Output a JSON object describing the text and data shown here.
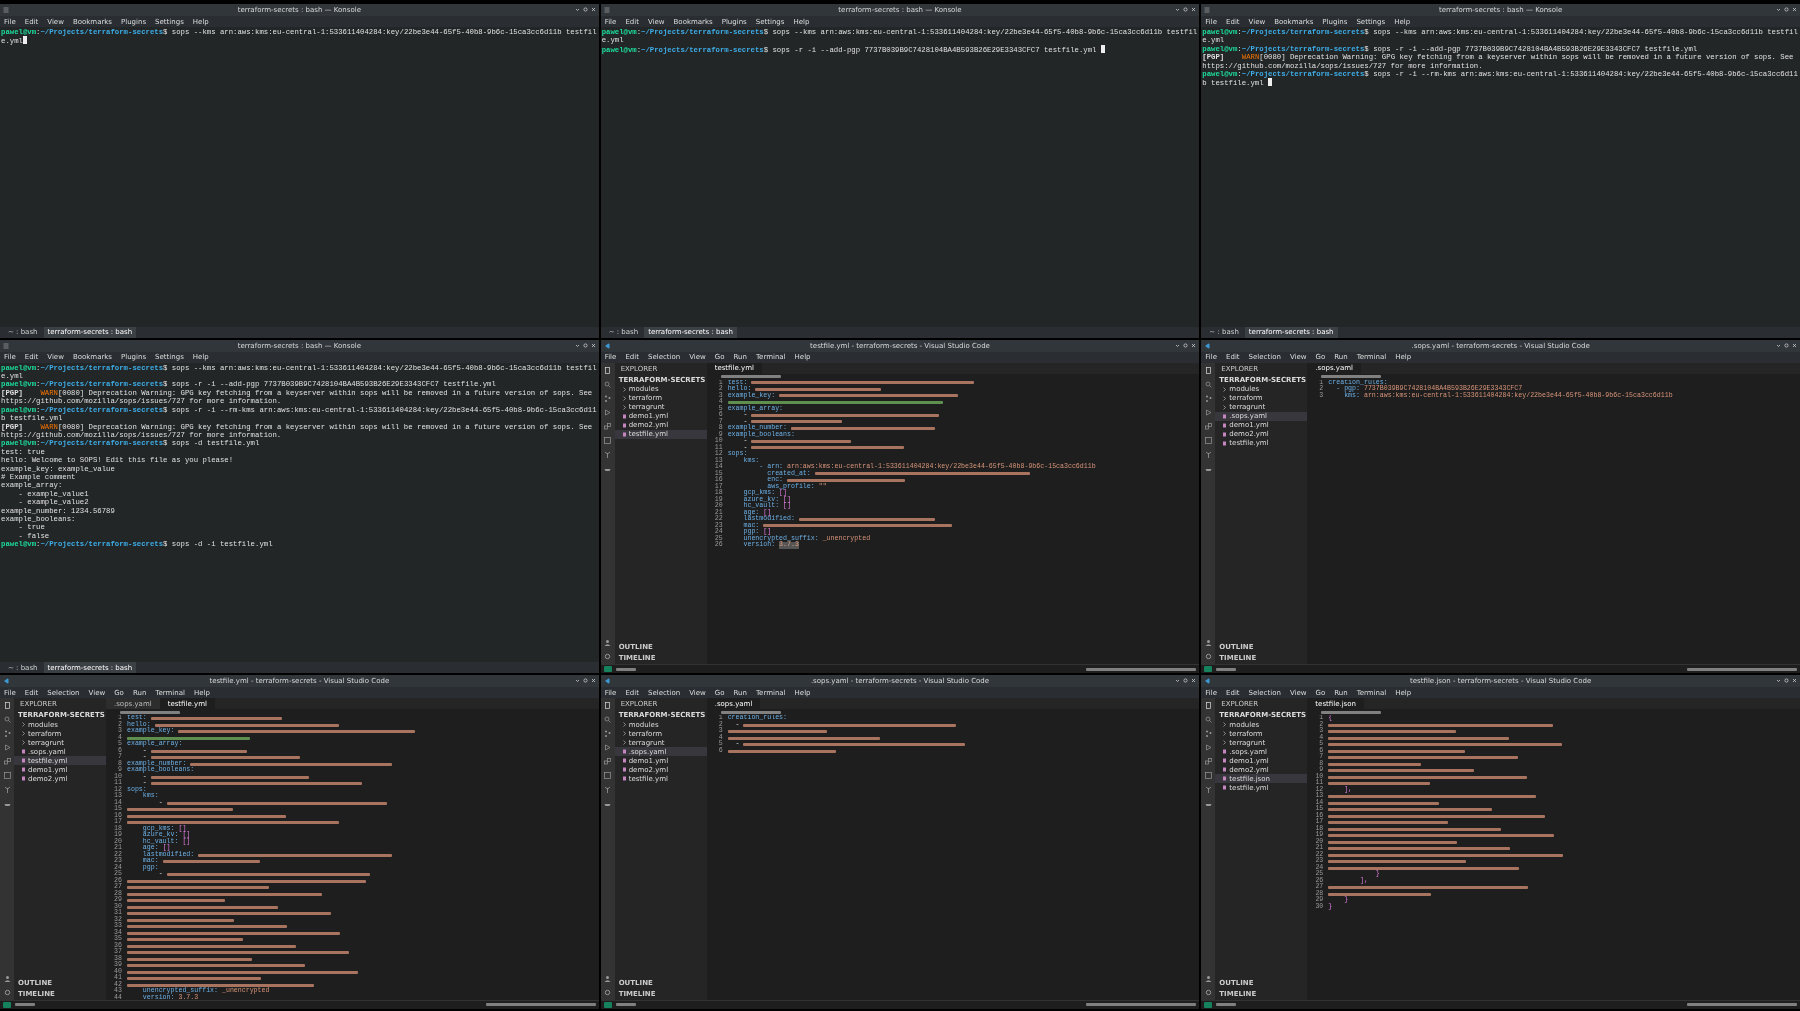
{
  "panels": [
    {
      "kind": "terminal",
      "title": "terraform-secrets : bash — Konsole",
      "menu": [
        "File",
        "Edit",
        "View",
        "Bookmarks",
        "Plugins",
        "Settings",
        "Help"
      ],
      "lines": [
        {
          "kind": "prompt",
          "user": "pawel@vm",
          "colon": ":",
          "path": "~/Projects/terraform-secrets",
          "sign": "$",
          "command": " sops --kms arn:aws:kms:eu-central-1:533611404284:key/22be3e44-65f5-40b8-9b6c-15ca3cc6d11b testfile.yml",
          "cursor": true
        }
      ],
      "tabs": [
        {
          "label": "~ : bash",
          "selected": false
        },
        {
          "label": "terraform-secrets : bash",
          "selected": true
        }
      ]
    },
    {
      "kind": "terminal",
      "title": "terraform-secrets : bash — Konsole",
      "menu": [
        "File",
        "Edit",
        "View",
        "Bookmarks",
        "Plugins",
        "Settings",
        "Help"
      ],
      "lines": [
        {
          "kind": "prompt",
          "user": "pawel@vm",
          "colon": ":",
          "path": "~/Projects/terraform-secrets",
          "sign": "$",
          "command": " sops --kms arn:aws:kms:eu-central-1:533611404284:key/22be3e44-65f5-40b8-9b6c-15ca3cc6d11b testfile.yml"
        },
        {
          "kind": "prompt",
          "user": "pawel@vm",
          "colon": ":",
          "path": "~/Projects/terraform-secrets",
          "sign": "$",
          "command": " sops -r -i --add-pgp 7737B039B9C7428104BA4B593B26E29E3343CFC7 testfile.yml ",
          "cursor": true
        }
      ],
      "tabs": [
        {
          "label": "~ : bash",
          "selected": false
        },
        {
          "label": "terraform-secrets : bash",
          "selected": true
        }
      ]
    },
    {
      "kind": "terminal",
      "title": "terraform-secrets : bash — Konsole",
      "menu": [
        "File",
        "Edit",
        "View",
        "Bookmarks",
        "Plugins",
        "Settings",
        "Help"
      ],
      "lines": [
        {
          "kind": "prompt",
          "user": "pawel@vm",
          "colon": ":",
          "path": "~/Projects/terraform-secrets",
          "sign": "$",
          "command": " sops --kms arn:aws:kms:eu-central-1:533611404284:key/22be3e44-65f5-40b8-9b6c-15ca3cc6d11b testfile.yml"
        },
        {
          "kind": "prompt",
          "user": "pawel@vm",
          "colon": ":",
          "path": "~/Projects/terraform-secrets",
          "sign": "$",
          "command": " sops -r -i --add-pgp 7737B039B9C7428104BA4B593B26E29E3343CFC7 testfile.yml"
        },
        {
          "kind": "warn",
          "tag": "[PGP]",
          "level": "WARN",
          "text": "[0080] Deprecation Warning: GPG key fetching from a keyserver within sops will be removed in a future version of sops. See https://github.com/mozilla/sops/issues/727 for more information."
        },
        {
          "kind": "prompt",
          "user": "pawel@vm",
          "colon": ":",
          "path": "~/Projects/terraform-secrets",
          "sign": "$",
          "command": " sops -r -i --rm-kms arn:aws:kms:eu-central-1:533611404284:key/22be3e44-65f5-40b8-9b6c-15ca3cc6d11b testfile.yml ",
          "cursor": true
        }
      ],
      "tabs": [
        {
          "label": "~ : bash",
          "selected": false
        },
        {
          "label": "terraform-secrets : bash",
          "selected": true
        }
      ]
    },
    {
      "kind": "terminal",
      "title": "terraform-secrets : bash — Konsole",
      "menu": [
        "File",
        "Edit",
        "View",
        "Bookmarks",
        "Plugins",
        "Settings",
        "Help"
      ],
      "lines": [
        {
          "kind": "prompt",
          "user": "pawel@vm",
          "colon": ":",
          "path": "~/Projects/terraform-secrets",
          "sign": "$",
          "command": " sops --kms arn:aws:kms:eu-central-1:533611404284:key/22be3e44-65f5-40b8-9b6c-15ca3cc6d11b testfile.yml"
        },
        {
          "kind": "prompt",
          "user": "pawel@vm",
          "colon": ":",
          "path": "~/Projects/terraform-secrets",
          "sign": "$",
          "command": " sops -r -i --add-pgp 7737B039B9C7428104BA4B593B26E29E3343CFC7 testfile.yml"
        },
        {
          "kind": "warn",
          "tag": "[PGP]",
          "level": "WARN",
          "text": "[0080] Deprecation Warning: GPG key fetching from a keyserver within sops will be removed in a future version of sops. See https://github.com/mozilla/sops/issues/727 for more information."
        },
        {
          "kind": "prompt",
          "user": "pawel@vm",
          "colon": ":",
          "path": "~/Projects/terraform-secrets",
          "sign": "$",
          "command": " sops -r -i --rm-kms arn:aws:kms:eu-central-1:533611404284:key/22be3e44-65f5-40b8-9b6c-15ca3cc6d11b testfile.yml"
        },
        {
          "kind": "warn",
          "tag": "[PGP]",
          "level": "WARN",
          "text": "[0080] Deprecation Warning: GPG key fetching from a keyserver within sops will be removed in a future version of sops. See https://github.com/mozilla/sops/issues/727 for more information."
        },
        {
          "kind": "prompt",
          "user": "pawel@vm",
          "colon": ":",
          "path": "~/Projects/terraform-secrets",
          "sign": "$",
          "command": " sops -d testfile.yml"
        },
        {
          "kind": "output",
          "text": "test: true"
        },
        {
          "kind": "output",
          "text": "hello: Welcome to SOPS! Edit this file as you please!"
        },
        {
          "kind": "output",
          "text": "example_key: example_value"
        },
        {
          "kind": "output",
          "text": "# Example comment"
        },
        {
          "kind": "output",
          "text": "example_array:"
        },
        {
          "kind": "output",
          "text": "    - example_value1"
        },
        {
          "kind": "output",
          "text": "    - example_value2"
        },
        {
          "kind": "output",
          "text": "example_number: 1234.56789"
        },
        {
          "kind": "output",
          "text": "example_booleans:"
        },
        {
          "kind": "output",
          "text": "    - true"
        },
        {
          "kind": "output",
          "text": "    - false"
        },
        {
          "kind": "prompt",
          "user": "pawel@vm",
          "colon": ":",
          "path": "~/Projects/terraform-secrets",
          "sign": "$",
          "command": " sops -d -i testfile.yml"
        }
      ],
      "tabs": [
        {
          "label": "~ : bash",
          "selected": false
        },
        {
          "label": "terraform-secrets : bash",
          "selected": true
        }
      ]
    },
    {
      "kind": "editor",
      "title": "testfile.yml - terraform-secrets - Visual Studio Code",
      "menu": [
        "File",
        "Edit",
        "Selection",
        "View",
        "Go",
        "Run",
        "Terminal",
        "Help"
      ],
      "explorer": "EXPLORER",
      "folder": "TERRAFORM-SECRETS",
      "files": [
        {
          "kind": "folder",
          "label": "modules",
          "selected": false
        },
        {
          "kind": "folder",
          "label": "terraform",
          "selected": false
        },
        {
          "kind": "folder",
          "label": "terragrunt",
          "selected": false
        },
        {
          "kind": "file",
          "label": "demo1.yml",
          "selected": false
        },
        {
          "kind": "file",
          "label": "demo2.yml",
          "selected": false
        },
        {
          "kind": "file",
          "label": "testfile.yml",
          "selected": true
        }
      ],
      "tabs": [
        {
          "label": "testfile.yml",
          "selected": true
        }
      ],
      "outline": [
        "OUTLINE",
        "TIMELINE"
      ],
      "code": [
        {
          "n": "1",
          "parts": [
            {
              "kind": "key",
              "text": "test: "
            },
            {
              "kind": "enc"
            }
          ]
        },
        {
          "n": "2",
          "parts": [
            {
              "kind": "key",
              "text": "hello: "
            },
            {
              "kind": "enc"
            }
          ]
        },
        {
          "n": "3",
          "parts": [
            {
              "kind": "key",
              "text": "example_key: "
            },
            {
              "kind": "enc"
            }
          ]
        },
        {
          "n": "4",
          "parts": [
            {
              "kind": "comment"
            }
          ]
        },
        {
          "n": "5",
          "parts": [
            {
              "kind": "key",
              "text": "example_array:"
            }
          ]
        },
        {
          "n": "6",
          "parts": [
            {
              "kind": "plain",
              "text": "    - "
            },
            {
              "kind": "enc"
            }
          ]
        },
        {
          "n": "7",
          "parts": [
            {
              "kind": "plain",
              "text": "    - "
            },
            {
              "kind": "enc"
            }
          ]
        },
        {
          "n": "8",
          "parts": [
            {
              "kind": "key",
              "text": "example_number: "
            },
            {
              "kind": "enc"
            }
          ]
        },
        {
          "n": "9",
          "parts": [
            {
              "kind": "key",
              "text": "example_booleans:"
            }
          ]
        },
        {
          "n": "10",
          "parts": [
            {
              "kind": "plain",
              "text": "    - "
            },
            {
              "kind": "enc"
            }
          ]
        },
        {
          "n": "11",
          "parts": [
            {
              "kind": "plain",
              "text": "    - "
            },
            {
              "kind": "enc"
            }
          ]
        },
        {
          "n": "12",
          "parts": [
            {
              "kind": "key",
              "text": "sops:"
            }
          ]
        },
        {
          "n": "13",
          "parts": [
            {
              "kind": "key",
              "text": "    kms:"
            }
          ]
        },
        {
          "n": "14",
          "parts": [
            {
              "kind": "key",
              "text": "        - arn: "
            },
            {
              "kind": "value",
              "text": "arn:aws:kms:eu-central-1:533611404284:key/22be3e44-65f5-40b8-9b6c-15ca3cc6d11b"
            }
          ]
        },
        {
          "n": "15",
          "parts": [
            {
              "kind": "key",
              "text": "          created_at: "
            },
            {
              "kind": "enc"
            }
          ]
        },
        {
          "n": "16",
          "parts": [
            {
              "kind": "key",
              "text": "          enc: "
            },
            {
              "kind": "enc"
            }
          ]
        },
        {
          "n": "17",
          "parts": [
            {
              "kind": "key",
              "text": "          aws_profile: "
            },
            {
              "kind": "value",
              "text": "\"\""
            }
          ]
        },
        {
          "n": "18",
          "parts": [
            {
              "kind": "key",
              "text": "    gcp_kms: "
            },
            {
              "kind": "bracket",
              "text": "[]"
            }
          ]
        },
        {
          "n": "19",
          "parts": [
            {
              "kind": "key",
              "text": "    azure_kv: "
            },
            {
              "kind": "bracket",
              "text": "[]"
            }
          ]
        },
        {
          "n": "20",
          "parts": [
            {
              "kind": "key",
              "text": "    hc_vault: "
            },
            {
              "kind": "bracket",
              "text": "[]"
            }
          ]
        },
        {
          "n": "21",
          "parts": [
            {
              "kind": "key",
              "text": "    age: "
            },
            {
              "kind": "bracket",
              "text": "[]"
            }
          ]
        },
        {
          "n": "22",
          "parts": [
            {
              "kind": "key",
              "text": "    lastmodified: "
            },
            {
              "kind": "enc"
            }
          ]
        },
        {
          "n": "23",
          "parts": [
            {
              "kind": "key",
              "text": "    mac: "
            },
            {
              "kind": "enc"
            }
          ]
        },
        {
          "n": "24",
          "parts": [
            {
              "kind": "key",
              "text": "    pgp: "
            },
            {
              "kind": "bracket",
              "text": "[]"
            }
          ]
        },
        {
          "n": "25",
          "parts": [
            {
              "kind": "key",
              "text": "    unencrypted_suffix: "
            },
            {
              "kind": "value",
              "text": "_unencrypted"
            }
          ]
        },
        {
          "n": "26",
          "parts": [
            {
              "kind": "key",
              "text": "    version: "
            },
            {
              "kind": "highlight",
              "text": "3.7.3"
            }
          ]
        }
      ]
    },
    {
      "kind": "editor",
      "title": ".sops.yaml - terraform-secrets - Visual Studio Code",
      "menu": [
        "File",
        "Edit",
        "Selection",
        "View",
        "Go",
        "Run",
        "Terminal",
        "Help"
      ],
      "explorer": "EXPLORER",
      "folder": "TERRAFORM-SECRETS",
      "files": [
        {
          "kind": "folder",
          "label": "modules",
          "selected": false
        },
        {
          "kind": "folder",
          "label": "terraform",
          "selected": false
        },
        {
          "kind": "folder",
          "label": "terragrunt",
          "selected": false
        },
        {
          "kind": "file",
          "label": ".sops.yaml",
          "selected": true
        },
        {
          "kind": "file",
          "label": "demo1.yml",
          "selected": false
        },
        {
          "kind": "file",
          "label": "demo2.yml",
          "selected": false
        },
        {
          "kind": "file",
          "label": "testfile.yml",
          "selected": false
        }
      ],
      "tabs": [
        {
          "label": ".sops.yaml",
          "selected": true
        }
      ],
      "outline": [
        "OUTLINE",
        "TIMELINE"
      ],
      "code": [
        {
          "n": "1",
          "parts": [
            {
              "kind": "key",
              "text": "creation_rules:"
            }
          ]
        },
        {
          "n": "2",
          "parts": [
            {
              "kind": "key",
              "text": "  - pgp: "
            },
            {
              "kind": "value",
              "text": "7737B039B9C7428104BA4B593B26E29E3343CFC7"
            }
          ]
        },
        {
          "n": "3",
          "parts": [
            {
              "kind": "key",
              "text": "    kms: "
            },
            {
              "kind": "value",
              "text": "arn:aws:kms:eu-central-1:533611404284:key/22be3e44-65f5-40b8-9b6c-15ca3cc6d11b"
            }
          ]
        }
      ]
    },
    {
      "kind": "editor",
      "title": "testfile.yml - terraform-secrets - Visual Studio Code",
      "menu": [
        "File",
        "Edit",
        "Selection",
        "View",
        "Go",
        "Run",
        "Terminal",
        "Help"
      ],
      "explorer": "EXPLORER",
      "folder": "TERRAFORM-SECRETS",
      "files": [
        {
          "kind": "folder",
          "label": "modules",
          "selected": false
        },
        {
          "kind": "folder",
          "label": "terraform",
          "selected": false
        },
        {
          "kind": "folder",
          "label": "terragrunt",
          "selected": false
        },
        {
          "kind": "file",
          "label": ".sops.yaml",
          "selected": false
        },
        {
          "kind": "file",
          "label": "testfile.yml",
          "selected": true
        },
        {
          "kind": "file",
          "label": "demo1.yml",
          "selected": false
        },
        {
          "kind": "file",
          "label": "demo2.yml",
          "selected": false
        }
      ],
      "tabs": [
        {
          "label": ".sops.yaml",
          "selected": false
        },
        {
          "label": "testfile.yml",
          "selected": true
        }
      ],
      "outline": [
        "OUTLINE",
        "TIMELINE"
      ],
      "code": [
        {
          "n": "1",
          "parts": [
            {
              "kind": "key",
              "text": "test: "
            },
            {
              "kind": "enc"
            }
          ]
        },
        {
          "n": "2",
          "parts": [
            {
              "kind": "key",
              "text": "hello: "
            },
            {
              "kind": "enc"
            }
          ]
        },
        {
          "n": "3",
          "parts": [
            {
              "kind": "key",
              "text": "example_key: "
            },
            {
              "kind": "enc"
            }
          ]
        },
        {
          "n": "4",
          "parts": [
            {
              "kind": "comment"
            }
          ]
        },
        {
          "n": "5",
          "parts": [
            {
              "kind": "key",
              "text": "example_array:"
            }
          ]
        },
        {
          "n": "6",
          "parts": [
            {
              "kind": "plain",
              "text": "    - "
            },
            {
              "kind": "enc"
            }
          ]
        },
        {
          "n": "7",
          "parts": [
            {
              "kind": "plain",
              "text": "    - "
            },
            {
              "kind": "enc"
            }
          ]
        },
        {
          "n": "8",
          "parts": [
            {
              "kind": "key",
              "text": "example_number: "
            },
            {
              "kind": "enc"
            }
          ]
        },
        {
          "n": "9",
          "parts": [
            {
              "kind": "key",
              "text": "example_booleans:"
            }
          ]
        },
        {
          "n": "10",
          "parts": [
            {
              "kind": "plain",
              "text": "    - "
            },
            {
              "kind": "enc"
            }
          ]
        },
        {
          "n": "11",
          "parts": [
            {
              "kind": "plain",
              "text": "    - "
            },
            {
              "kind": "enc"
            }
          ]
        },
        {
          "n": "12",
          "parts": [
            {
              "kind": "key",
              "text": "sops:"
            }
          ]
        },
        {
          "n": "13",
          "parts": [
            {
              "kind": "key",
              "text": "    kms:"
            }
          ]
        },
        {
          "n": "14",
          "parts": [
            {
              "kind": "plain",
              "text": "        - "
            },
            {
              "kind": "enc"
            }
          ]
        },
        {
          "n": "15",
          "parts": [
            {
              "kind": "enc"
            }
          ]
        },
        {
          "n": "16",
          "parts": [
            {
              "kind": "enc"
            }
          ]
        },
        {
          "n": "17",
          "parts": [
            {
              "kind": "enc"
            }
          ]
        },
        {
          "n": "18",
          "parts": [
            {
              "kind": "key",
              "text": "    gcp_kms: "
            },
            {
              "kind": "bracket",
              "text": "[]"
            }
          ]
        },
        {
          "n": "19",
          "parts": [
            {
              "kind": "key",
              "text": "    azure_kv: "
            },
            {
              "kind": "bracket",
              "text": "[]"
            }
          ]
        },
        {
          "n": "20",
          "parts": [
            {
              "kind": "key",
              "text": "    hc_vault: "
            },
            {
              "kind": "bracket",
              "text": "[]"
            }
          ]
        },
        {
          "n": "21",
          "parts": [
            {
              "kind": "key",
              "text": "    age: "
            },
            {
              "kind": "bracket",
              "text": "[]"
            }
          ]
        },
        {
          "n": "22",
          "parts": [
            {
              "kind": "key",
              "text": "    lastmodified: "
            },
            {
              "kind": "enc"
            }
          ]
        },
        {
          "n": "23",
          "parts": [
            {
              "kind": "key",
              "text": "    mac: "
            },
            {
              "kind": "enc"
            }
          ]
        },
        {
          "n": "24",
          "parts": [
            {
              "kind": "key",
              "text": "    pgp:"
            }
          ]
        },
        {
          "n": "25",
          "parts": [
            {
              "kind": "plain",
              "text": "        - "
            },
            {
              "kind": "enc"
            }
          ]
        },
        {
          "n": "26",
          "parts": [
            {
              "kind": "enc"
            }
          ]
        },
        {
          "n": "27",
          "parts": [
            {
              "kind": "enc"
            }
          ]
        },
        {
          "n": "28",
          "parts": [
            {
              "kind": "enc"
            }
          ]
        },
        {
          "n": "29",
          "parts": [
            {
              "kind": "enc"
            }
          ]
        },
        {
          "n": "30",
          "parts": [
            {
              "kind": "enc"
            }
          ]
        },
        {
          "n": "31",
          "parts": [
            {
              "kind": "enc"
            }
          ]
        },
        {
          "n": "32",
          "parts": [
            {
              "kind": "enc"
            }
          ]
        },
        {
          "n": "33",
          "parts": [
            {
              "kind": "enc"
            }
          ]
        },
        {
          "n": "34",
          "parts": [
            {
              "kind": "enc"
            }
          ]
        },
        {
          "n": "35",
          "parts": [
            {
              "kind": "enc"
            }
          ]
        },
        {
          "n": "36",
          "parts": [
            {
              "kind": "enc"
            }
          ]
        },
        {
          "n": "37",
          "parts": [
            {
              "kind": "enc"
            }
          ]
        },
        {
          "n": "38",
          "parts": [
            {
              "kind": "enc"
            }
          ]
        },
        {
          "n": "39",
          "parts": [
            {
              "kind": "enc"
            }
          ]
        },
        {
          "n": "40",
          "parts": [
            {
              "kind": "enc"
            }
          ]
        },
        {
          "n": "41",
          "parts": [
            {
              "kind": "enc"
            }
          ]
        },
        {
          "n": "42",
          "parts": [
            {
              "kind": "enc"
            }
          ]
        },
        {
          "n": "43",
          "parts": [
            {
              "kind": "key",
              "text": "    unencrypted_suffix: "
            },
            {
              "kind": "value",
              "text": "_unencrypted"
            }
          ]
        },
        {
          "n": "44",
          "parts": [
            {
              "kind": "key",
              "text": "    version: "
            },
            {
              "kind": "value",
              "text": "3.7.3"
            }
          ]
        }
      ]
    },
    {
      "kind": "editor",
      "title": ".sops.yaml - terraform-secrets - Visual Studio Code",
      "menu": [
        "File",
        "Edit",
        "Selection",
        "View",
        "Go",
        "Run",
        "Terminal",
        "Help"
      ],
      "explorer": "EXPLORER",
      "folder": "TERRAFORM-SECRETS",
      "files": [
        {
          "kind": "folder",
          "label": "modules",
          "selected": false
        },
        {
          "kind": "folder",
          "label": "terraform",
          "selected": false
        },
        {
          "kind": "folder",
          "label": "terragrunt",
          "selected": false
        },
        {
          "kind": "file",
          "label": ".sops.yaml",
          "selected": true
        },
        {
          "kind": "file",
          "label": "demo1.yml",
          "selected": false
        },
        {
          "kind": "file",
          "label": "demo2.yml",
          "selected": false
        },
        {
          "kind": "file",
          "label": "testfile.yml",
          "selected": false
        }
      ],
      "tabs": [
        {
          "label": ".sops.yaml",
          "selected": true
        }
      ],
      "outline": [
        "OUTLINE",
        "TIMELINE"
      ],
      "code": [
        {
          "n": "1",
          "parts": [
            {
              "kind": "key",
              "text": "creation_rules:"
            }
          ]
        },
        {
          "n": "2",
          "parts": [
            {
              "kind": "plain",
              "text": "  - "
            },
            {
              "kind": "enc"
            }
          ]
        },
        {
          "n": "3",
          "parts": [
            {
              "kind": "enc"
            }
          ]
        },
        {
          "n": "4",
          "parts": [
            {
              "kind": "enc"
            }
          ]
        },
        {
          "n": "5",
          "parts": [
            {
              "kind": "plain",
              "text": "  - "
            },
            {
              "kind": "enc"
            }
          ]
        },
        {
          "n": "6",
          "parts": [
            {
              "kind": "enc"
            }
          ]
        }
      ]
    },
    {
      "kind": "editor",
      "title": "testfile.json - terraform-secrets - Visual Studio Code",
      "menu": [
        "File",
        "Edit",
        "Selection",
        "View",
        "Go",
        "Run",
        "Terminal",
        "Help"
      ],
      "explorer": "EXPLORER",
      "folder": "TERRAFORM-SECRETS",
      "files": [
        {
          "kind": "folder",
          "label": "modules",
          "selected": false
        },
        {
          "kind": "folder",
          "label": "terraform",
          "selected": false
        },
        {
          "kind": "folder",
          "label": "terragrunt",
          "selected": false
        },
        {
          "kind": "file",
          "label": ".sops.yaml",
          "selected": false
        },
        {
          "kind": "file",
          "label": "demo1.yml",
          "selected": false
        },
        {
          "kind": "file",
          "label": "demo2.yml",
          "selected": false
        },
        {
          "kind": "file",
          "label": "testfile.json",
          "selected": true
        },
        {
          "kind": "file",
          "label": "testfile.yml",
          "selected": false
        }
      ],
      "tabs": [
        {
          "label": "testfile.json",
          "selected": true
        }
      ],
      "outline": [
        "OUTLINE",
        "TIMELINE"
      ],
      "code": [
        {
          "n": "1",
          "parts": [
            {
              "kind": "bracket",
              "text": "{"
            }
          ]
        },
        {
          "n": "2",
          "parts": [
            {
              "kind": "enc"
            }
          ]
        },
        {
          "n": "3",
          "parts": [
            {
              "kind": "enc"
            }
          ]
        },
        {
          "n": "4",
          "parts": [
            {
              "kind": "enc"
            }
          ]
        },
        {
          "n": "5",
          "parts": [
            {
              "kind": "enc"
            }
          ]
        },
        {
          "n": "6",
          "parts": [
            {
              "kind": "enc"
            }
          ]
        },
        {
          "n": "7",
          "parts": [
            {
              "kind": "enc"
            }
          ]
        },
        {
          "n": "8",
          "parts": [
            {
              "kind": "enc"
            }
          ]
        },
        {
          "n": "9",
          "parts": [
            {
              "kind": "enc"
            }
          ]
        },
        {
          "n": "10",
          "parts": [
            {
              "kind": "enc"
            }
          ]
        },
        {
          "n": "11",
          "parts": [
            {
              "kind": "enc"
            }
          ]
        },
        {
          "n": "12",
          "parts": [
            {
              "kind": "bracket",
              "text": "    ],"
            }
          ]
        },
        {
          "n": "13",
          "parts": [
            {
              "kind": "enc"
            }
          ]
        },
        {
          "n": "14",
          "parts": [
            {
              "kind": "enc"
            }
          ]
        },
        {
          "n": "15",
          "parts": [
            {
              "kind": "enc"
            }
          ]
        },
        {
          "n": "16",
          "parts": [
            {
              "kind": "enc"
            }
          ]
        },
        {
          "n": "17",
          "parts": [
            {
              "kind": "enc"
            }
          ]
        },
        {
          "n": "18",
          "parts": [
            {
              "kind": "enc"
            }
          ]
        },
        {
          "n": "19",
          "parts": [
            {
              "kind": "enc"
            }
          ]
        },
        {
          "n": "20",
          "parts": [
            {
              "kind": "enc"
            }
          ]
        },
        {
          "n": "21",
          "parts": [
            {
              "kind": "enc"
            }
          ]
        },
        {
          "n": "22",
          "parts": [
            {
              "kind": "enc"
            }
          ]
        },
        {
          "n": "23",
          "parts": [
            {
              "kind": "enc"
            }
          ]
        },
        {
          "n": "24",
          "parts": [
            {
              "kind": "enc"
            }
          ]
        },
        {
          "n": "25",
          "parts": [
            {
              "kind": "bracket",
              "text": "            }"
            }
          ]
        },
        {
          "n": "26",
          "parts": [
            {
              "kind": "bracket",
              "text": "        ],"
            }
          ]
        },
        {
          "n": "27",
          "parts": [
            {
              "kind": "enc"
            }
          ]
        },
        {
          "n": "28",
          "parts": [
            {
              "kind": "enc"
            }
          ]
        },
        {
          "n": "29",
          "parts": [
            {
              "kind": "bracket",
              "text": "    }"
            }
          ]
        },
        {
          "n": "30",
          "parts": [
            {
              "kind": "bracket",
              "text": "}"
            }
          ]
        }
      ]
    }
  ]
}
